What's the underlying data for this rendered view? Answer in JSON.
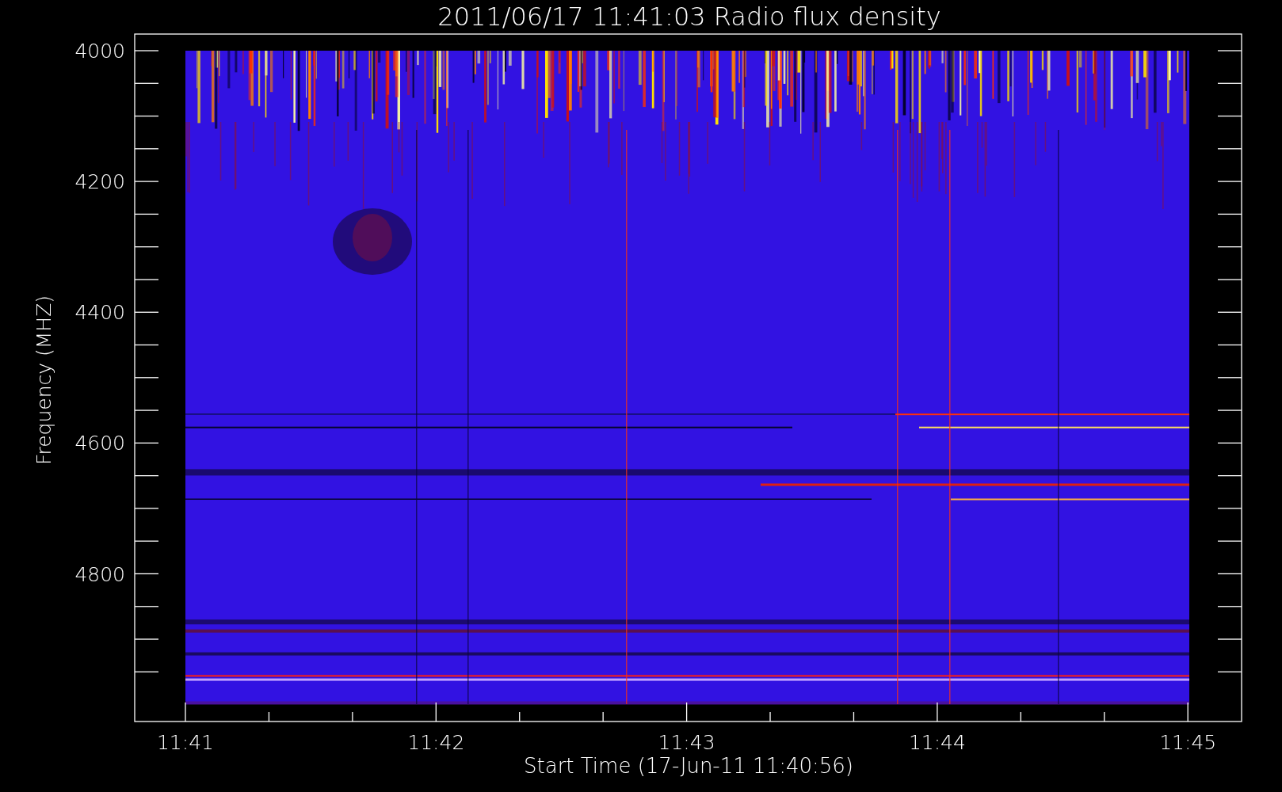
{
  "title": "2011/06/17 11:41:03 Radio flux density",
  "y_axis": {
    "label": "Frequency (MHZ)",
    "ticks": [
      "4000",
      "4200",
      "4400",
      "4600",
      "4800"
    ]
  },
  "x_axis": {
    "label": "Start Time (17-Jun-11 11:40:56)",
    "ticks": [
      "11:41",
      "11:42",
      "11:43",
      "11:44",
      "11:45"
    ]
  }
}
